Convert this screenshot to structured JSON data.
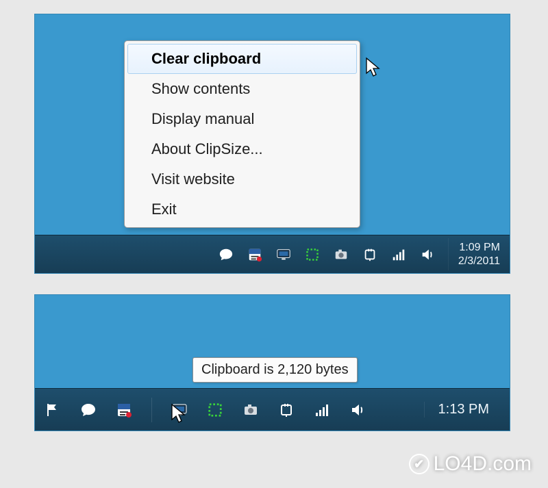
{
  "shot1": {
    "menu": {
      "items": [
        "Clear clipboard",
        "Show contents",
        "Display manual",
        "About ClipSize...",
        "Visit website",
        "Exit"
      ],
      "highlight_index": 0
    },
    "clock": {
      "time": "1:09 PM",
      "date": "2/3/2011"
    }
  },
  "shot2": {
    "tooltip": "Clipboard is 2,120 bytes",
    "clock": {
      "time": "1:13 PM"
    }
  },
  "watermark": "LO4D.com"
}
